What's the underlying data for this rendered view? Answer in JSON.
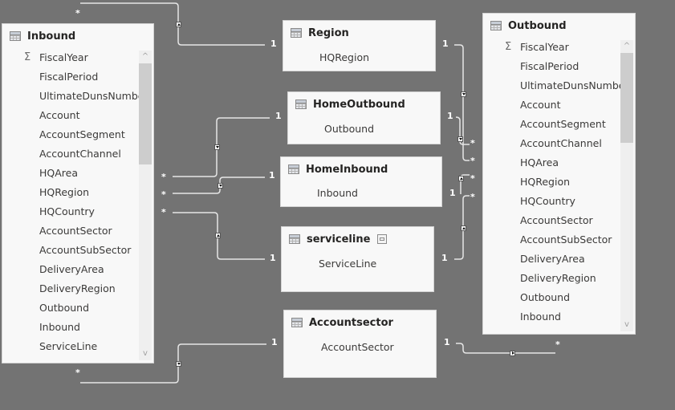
{
  "tables": {
    "inbound": {
      "title": "Inbound",
      "icon": "table-icon",
      "fields": [
        {
          "name": "FiscalYear",
          "icon": "sigma-icon"
        },
        {
          "name": "FiscalPeriod"
        },
        {
          "name": "UltimateDunsNumbe"
        },
        {
          "name": "Account"
        },
        {
          "name": "AccountSegment"
        },
        {
          "name": "AccountChannel"
        },
        {
          "name": "HQArea"
        },
        {
          "name": "HQRegion"
        },
        {
          "name": "HQCountry"
        },
        {
          "name": "AccountSector"
        },
        {
          "name": "AccountSubSector"
        },
        {
          "name": "DeliveryArea"
        },
        {
          "name": "DeliveryRegion"
        },
        {
          "name": "Outbound"
        },
        {
          "name": "Inbound"
        },
        {
          "name": "ServiceLine"
        }
      ]
    },
    "outbound": {
      "title": "Outbound",
      "icon": "table-icon",
      "fields": [
        {
          "name": "FiscalYear",
          "icon": "sigma-icon"
        },
        {
          "name": "FiscalPeriod"
        },
        {
          "name": "UltimateDunsNumbe"
        },
        {
          "name": "Account"
        },
        {
          "name": "AccountSegment"
        },
        {
          "name": "AccountChannel"
        },
        {
          "name": "HQArea"
        },
        {
          "name": "HQRegion"
        },
        {
          "name": "HQCountry"
        },
        {
          "name": "AccountSector"
        },
        {
          "name": "AccountSubSector"
        },
        {
          "name": "DeliveryArea"
        },
        {
          "name": "DeliveryRegion"
        },
        {
          "name": "Outbound"
        },
        {
          "name": "Inbound"
        }
      ]
    },
    "region": {
      "title": "Region",
      "icon": "table-icon",
      "field": "HQRegion"
    },
    "homeoutbound": {
      "title": "HomeOutbound",
      "icon": "table-icon",
      "field": "Outbound"
    },
    "homeinbound": {
      "title": "HomeInbound",
      "icon": "table-icon",
      "field": "Inbound"
    },
    "serviceline": {
      "title": "serviceline",
      "icon": "table-icon",
      "badge_icon": "hidden-table-icon",
      "field": "ServiceLine"
    },
    "accountsector": {
      "title": "Accountsector",
      "icon": "table-icon",
      "field": "AccountSector"
    }
  },
  "cardinality": {
    "one": "1",
    "many": "*"
  },
  "scroll_glyphs": {
    "up": "^",
    "down": "v"
  },
  "colors": {
    "canvas": "#737373",
    "card": "#f8f8f8",
    "line": "#e8e8e8",
    "label": "#ffffff"
  }
}
